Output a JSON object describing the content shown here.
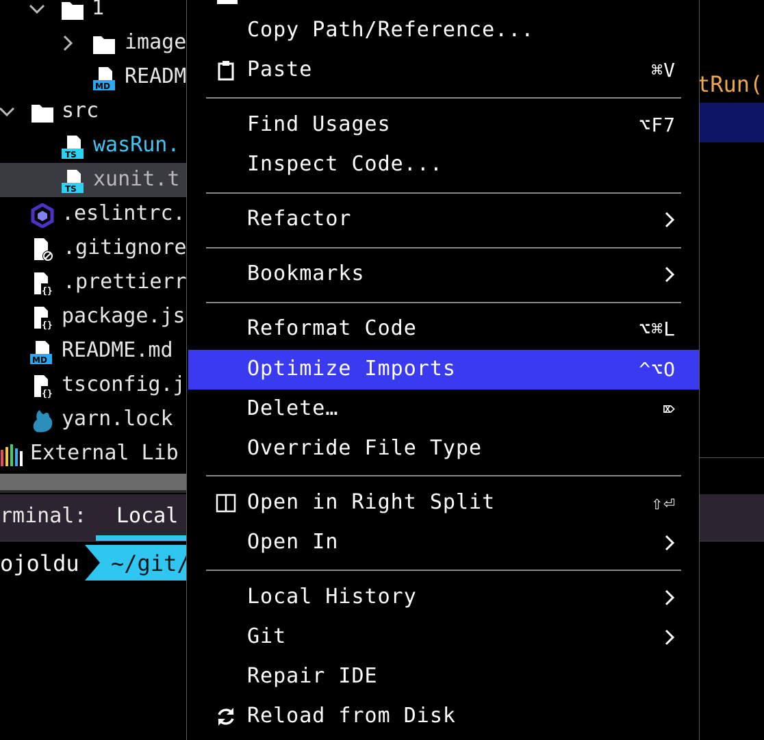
{
  "tree": {
    "items": [
      {
        "label": "1",
        "icon": "folder-icon",
        "chevron": "down"
      },
      {
        "label": "image",
        "icon": "folder-icon",
        "chevron": "right"
      },
      {
        "label": "READM",
        "icon": "markdown-file-icon",
        "chevron": ""
      },
      {
        "label": "src",
        "icon": "folder-icon",
        "chevron": "down"
      },
      {
        "label": "wasRun.",
        "icon": "typescript-file-icon",
        "chevron": ""
      },
      {
        "label": "xunit.t",
        "icon": "typescript-file-icon",
        "chevron": ""
      },
      {
        "label": ".eslintrc.",
        "icon": "eslint-icon",
        "chevron": ""
      },
      {
        "label": ".gitignore",
        "icon": "gitignore-file-icon",
        "chevron": ""
      },
      {
        "label": ".prettierr",
        "icon": "config-file-icon",
        "chevron": ""
      },
      {
        "label": "package.js",
        "icon": "json-file-icon",
        "chevron": ""
      },
      {
        "label": "README.md",
        "icon": "markdown-file-icon",
        "chevron": ""
      },
      {
        "label": "tsconfig.j",
        "icon": "json-file-icon",
        "chevron": ""
      },
      {
        "label": "yarn.lock",
        "icon": "yarn-icon",
        "chevron": ""
      },
      {
        "label": "External Lib",
        "icon": "library-icon",
        "chevron": ""
      }
    ],
    "icon_badges": {
      "md": "MD",
      "ts": "TS"
    }
  },
  "terminal": {
    "label": "rminal:",
    "tab": "Local",
    "prompt_user": "ojoldu",
    "prompt_path": "~/git/"
  },
  "editor": {
    "code_fragment": "tRun("
  },
  "menu": {
    "items": [
      {
        "label": "Copy Path/Reference...",
        "shortcut": "",
        "submenu": false,
        "icon": ""
      },
      {
        "label": "Paste",
        "shortcut": "⌘V",
        "submenu": false,
        "icon": "clipboard-icon"
      },
      {
        "label": "Find Usages",
        "shortcut": "⌥F7",
        "submenu": false,
        "icon": ""
      },
      {
        "label": "Inspect Code...",
        "shortcut": "",
        "submenu": false,
        "icon": ""
      },
      {
        "label": "Refactor",
        "shortcut": "",
        "submenu": true,
        "icon": ""
      },
      {
        "label": "Bookmarks",
        "shortcut": "",
        "submenu": true,
        "icon": ""
      },
      {
        "label": "Reformat Code",
        "shortcut": "⌥⌘L",
        "submenu": false,
        "icon": ""
      },
      {
        "label": "Optimize Imports",
        "shortcut": "^⌥O",
        "submenu": false,
        "icon": "",
        "highlighted": true
      },
      {
        "label": "Delete…",
        "shortcut": "⌦",
        "submenu": false,
        "icon": ""
      },
      {
        "label": "Override File Type",
        "shortcut": "",
        "submenu": false,
        "icon": ""
      },
      {
        "label": "Open in Right Split",
        "shortcut": "⇧⏎",
        "submenu": false,
        "icon": "split-icon"
      },
      {
        "label": "Open In",
        "shortcut": "",
        "submenu": true,
        "icon": ""
      },
      {
        "label": "Local History",
        "shortcut": "",
        "submenu": true,
        "icon": ""
      },
      {
        "label": "Git",
        "shortcut": "",
        "submenu": true,
        "icon": ""
      },
      {
        "label": "Repair IDE",
        "shortcut": "",
        "submenu": false,
        "icon": ""
      },
      {
        "label": "Reload from Disk",
        "shortcut": "",
        "submenu": false,
        "icon": "reload-icon"
      }
    ]
  },
  "colors": {
    "menu_highlight": "#3a3af0",
    "terminal_accent": "#30c6f2",
    "modified_file": "#3fc6f5",
    "typescript_badge": "#2ad4f0",
    "markdown_badge": "#2aa8f0",
    "eslint": "#4b32c3"
  }
}
